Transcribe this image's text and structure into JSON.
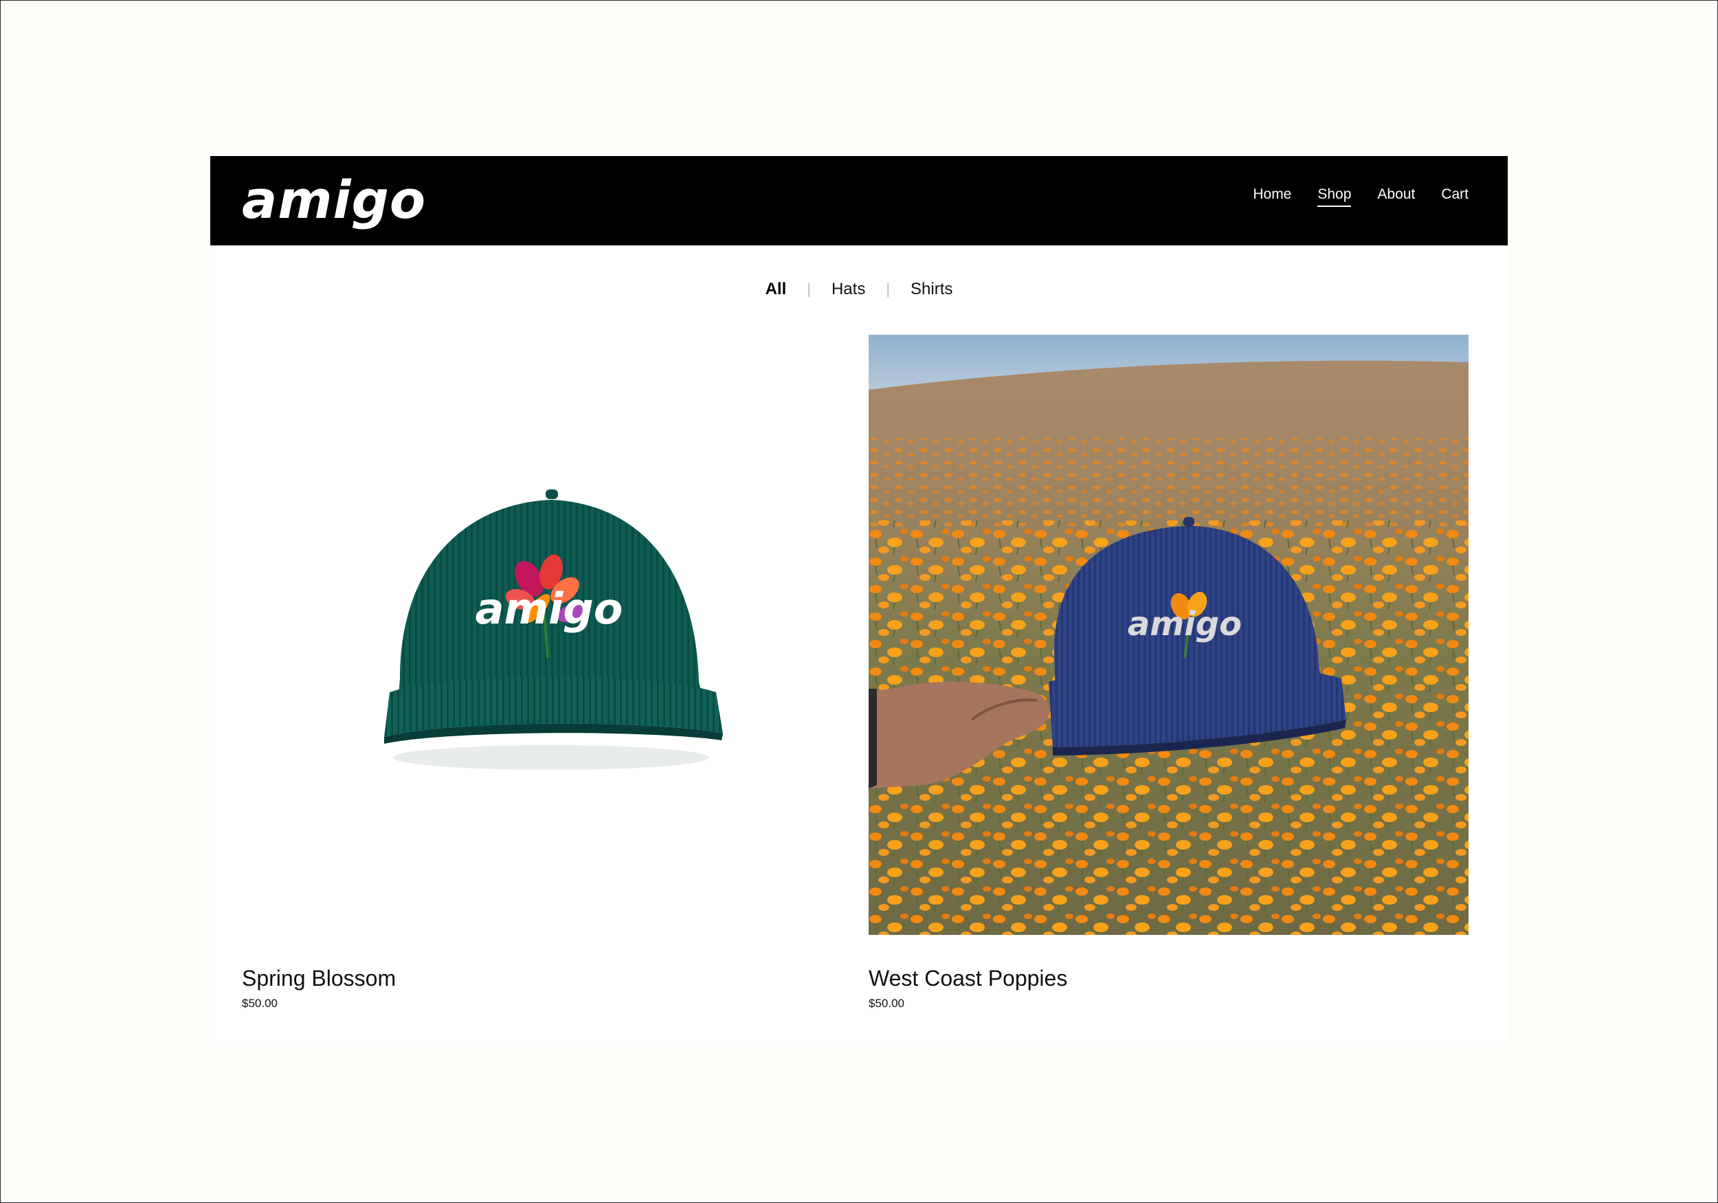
{
  "brand": {
    "logo_text": "amigo"
  },
  "nav": {
    "items": [
      {
        "label": "Home"
      },
      {
        "label": "Shop"
      },
      {
        "label": "About"
      },
      {
        "label": "Cart"
      }
    ]
  },
  "filters": {
    "items": [
      {
        "label": "All"
      },
      {
        "label": "Hats"
      },
      {
        "label": "Shirts"
      }
    ],
    "separator": "|"
  },
  "products": [
    {
      "title": "Spring Blossom",
      "price": "$50.00",
      "cap_logo": "amigo"
    },
    {
      "title": "West Coast Poppies",
      "price": "$50.00",
      "cap_logo": "amigo"
    }
  ],
  "colors": {
    "header_bg": "#000000",
    "green_cap": "#0d5b52",
    "blue_cap": "#2c3f82",
    "poppy": "#f08a14"
  }
}
